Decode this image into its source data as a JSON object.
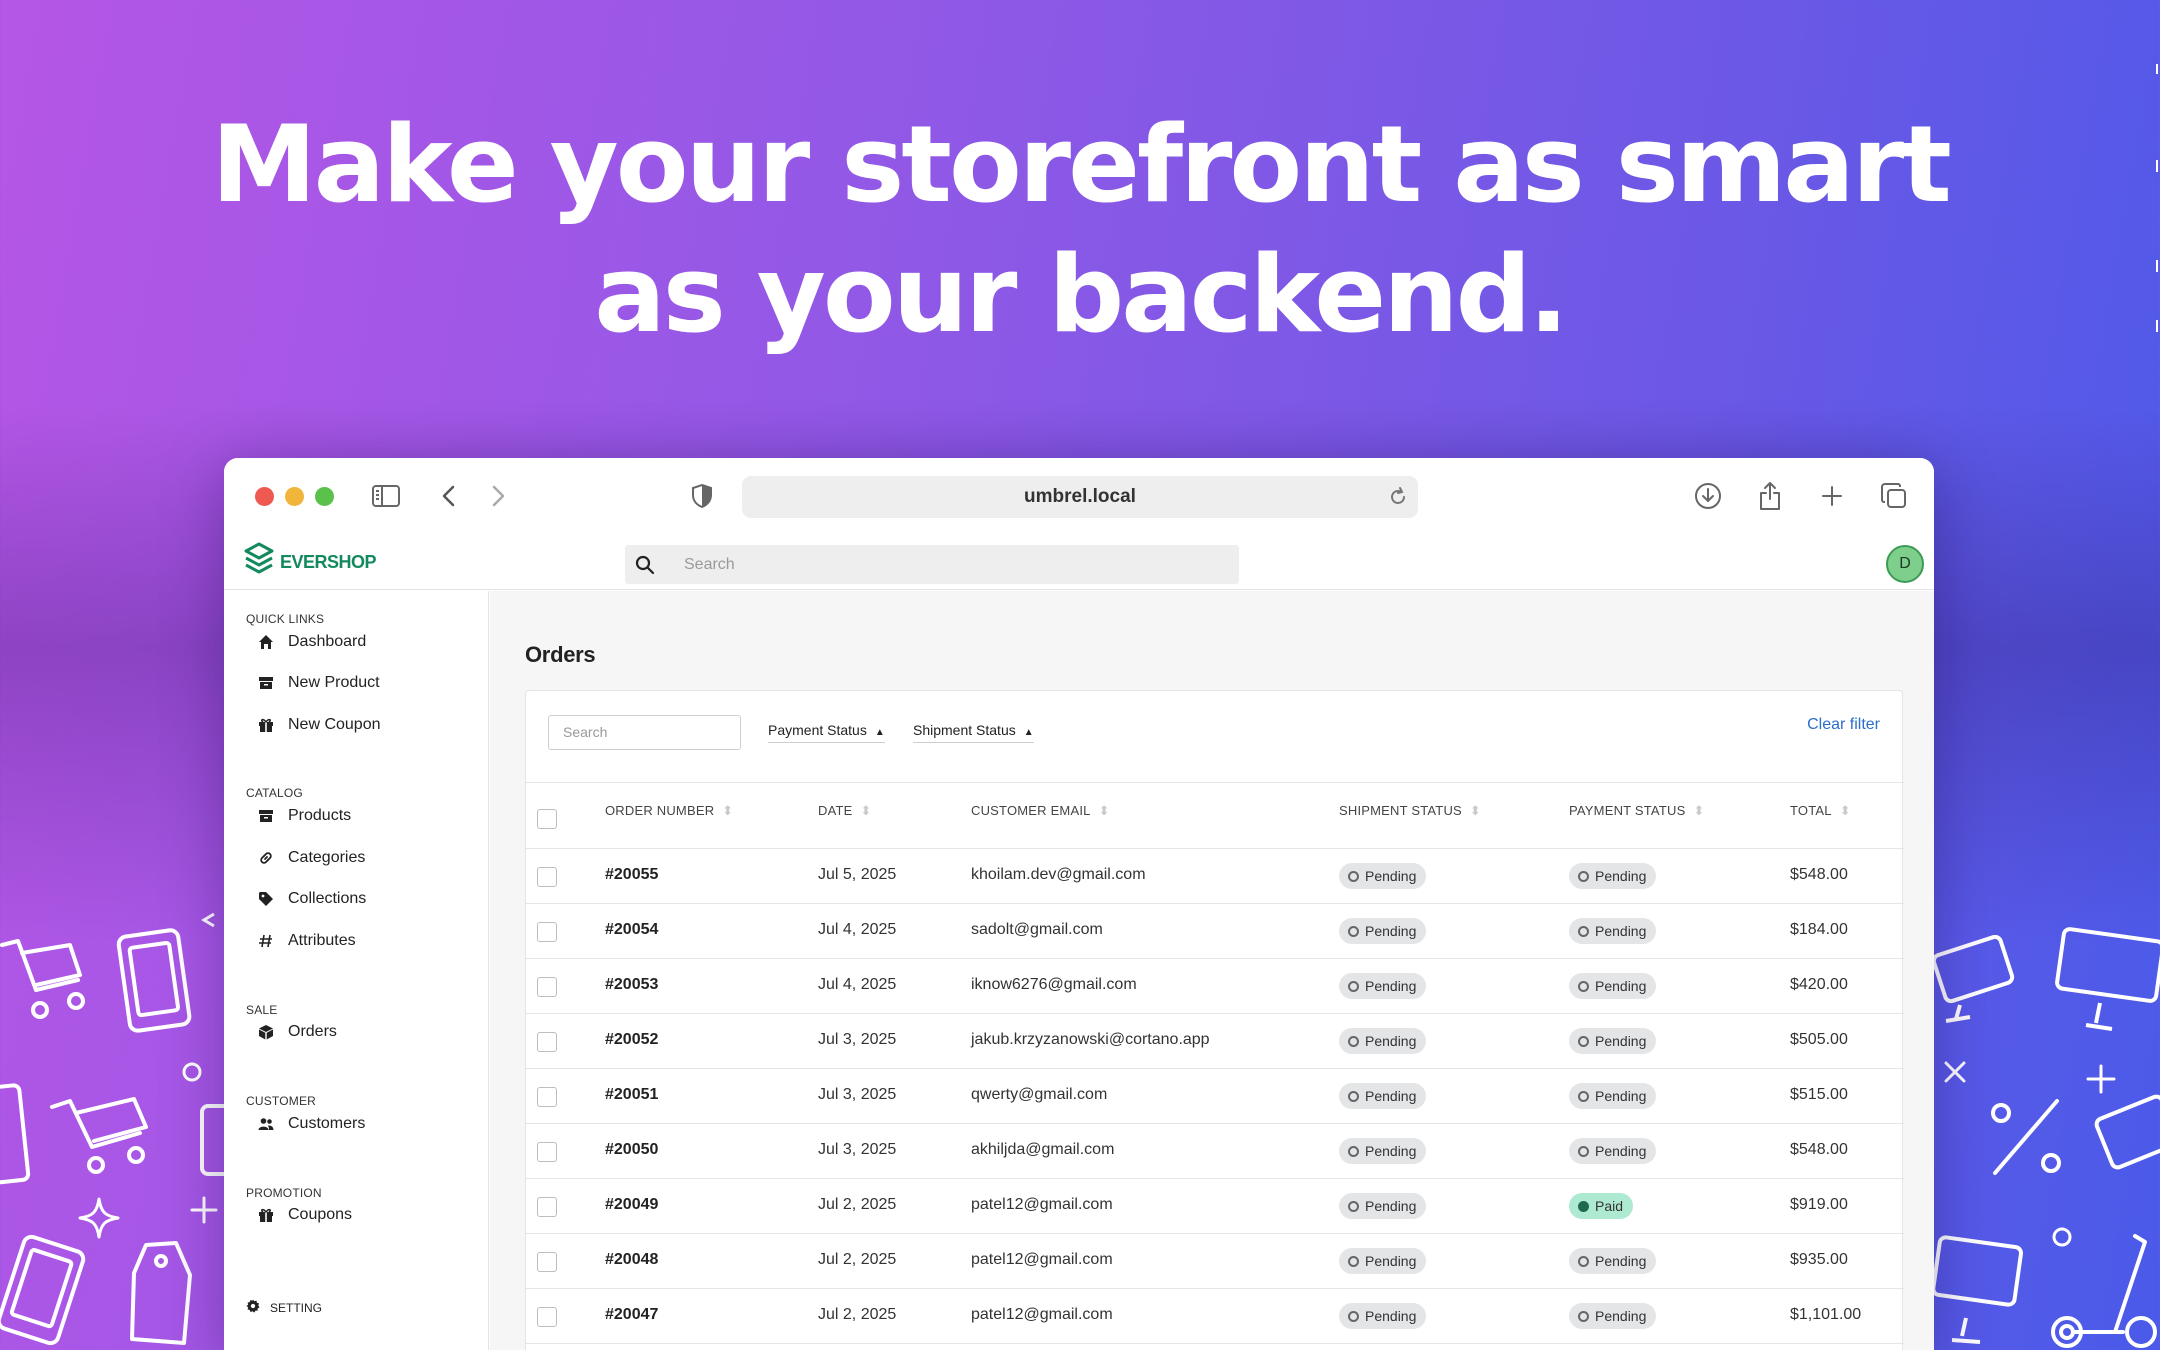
{
  "headline": {
    "line1": "Make your storefront as smart",
    "line2": "as your backend."
  },
  "browser": {
    "url": "umbrel.local"
  },
  "app": {
    "brand": "EVERSHOP",
    "search_placeholder": "Search",
    "avatar_initial": "D",
    "accent_color": "#138a5e"
  },
  "sidebar": {
    "sections": [
      {
        "title": "QUICK LINKS",
        "items": [
          {
            "label": "Dashboard",
            "icon": "home-icon"
          },
          {
            "label": "New Product",
            "icon": "archive-icon"
          },
          {
            "label": "New Coupon",
            "icon": "gift-icon"
          }
        ]
      },
      {
        "title": "CATALOG",
        "items": [
          {
            "label": "Products",
            "icon": "archive-icon"
          },
          {
            "label": "Categories",
            "icon": "link-icon"
          },
          {
            "label": "Collections",
            "icon": "tag-icon"
          },
          {
            "label": "Attributes",
            "icon": "hash-icon"
          }
        ]
      },
      {
        "title": "SALE",
        "items": [
          {
            "label": "Orders",
            "icon": "cube-icon"
          }
        ]
      },
      {
        "title": "CUSTOMER",
        "items": [
          {
            "label": "Customers",
            "icon": "users-icon"
          }
        ]
      },
      {
        "title": "PROMOTION",
        "items": [
          {
            "label": "Coupons",
            "icon": "gift-icon"
          }
        ]
      }
    ],
    "setting_label": "SETTING"
  },
  "orders": {
    "title": "Orders",
    "filters": {
      "search_placeholder": "Search",
      "payment_status": "Payment Status",
      "shipment_status": "Shipment Status",
      "clear_filter": "Clear filter"
    },
    "columns": {
      "order_number": "ORDER NUMBER",
      "date": "DATE",
      "customer_email": "CUSTOMER EMAIL",
      "shipment_status": "SHIPMENT STATUS",
      "payment_status": "PAYMENT STATUS",
      "total": "TOTAL"
    },
    "rows": [
      {
        "number": "#20055",
        "date": "Jul 5, 2025",
        "email": "khoilam.dev@gmail.com",
        "shipment": "Pending",
        "payment": "Pending",
        "total": "$548.00"
      },
      {
        "number": "#20054",
        "date": "Jul 4, 2025",
        "email": "sadolt@gmail.com",
        "shipment": "Pending",
        "payment": "Pending",
        "total": "$184.00"
      },
      {
        "number": "#20053",
        "date": "Jul 4, 2025",
        "email": "iknow6276@gmail.com",
        "shipment": "Pending",
        "payment": "Pending",
        "total": "$420.00"
      },
      {
        "number": "#20052",
        "date": "Jul 3, 2025",
        "email": "jakub.krzyzanowski@cortano.app",
        "shipment": "Pending",
        "payment": "Pending",
        "total": "$505.00"
      },
      {
        "number": "#20051",
        "date": "Jul 3, 2025",
        "email": "qwerty@gmail.com",
        "shipment": "Pending",
        "payment": "Pending",
        "total": "$515.00"
      },
      {
        "number": "#20050",
        "date": "Jul 3, 2025",
        "email": "akhiljda@gmail.com",
        "shipment": "Pending",
        "payment": "Pending",
        "total": "$548.00"
      },
      {
        "number": "#20049",
        "date": "Jul 2, 2025",
        "email": "patel12@gmail.com",
        "shipment": "Pending",
        "payment": "Paid",
        "total": "$919.00"
      },
      {
        "number": "#20048",
        "date": "Jul 2, 2025",
        "email": "patel12@gmail.com",
        "shipment": "Pending",
        "payment": "Pending",
        "total": "$935.00"
      },
      {
        "number": "#20047",
        "date": "Jul 2, 2025",
        "email": "patel12@gmail.com",
        "shipment": "Pending",
        "payment": "Pending",
        "total": "$1,101.00"
      }
    ]
  }
}
